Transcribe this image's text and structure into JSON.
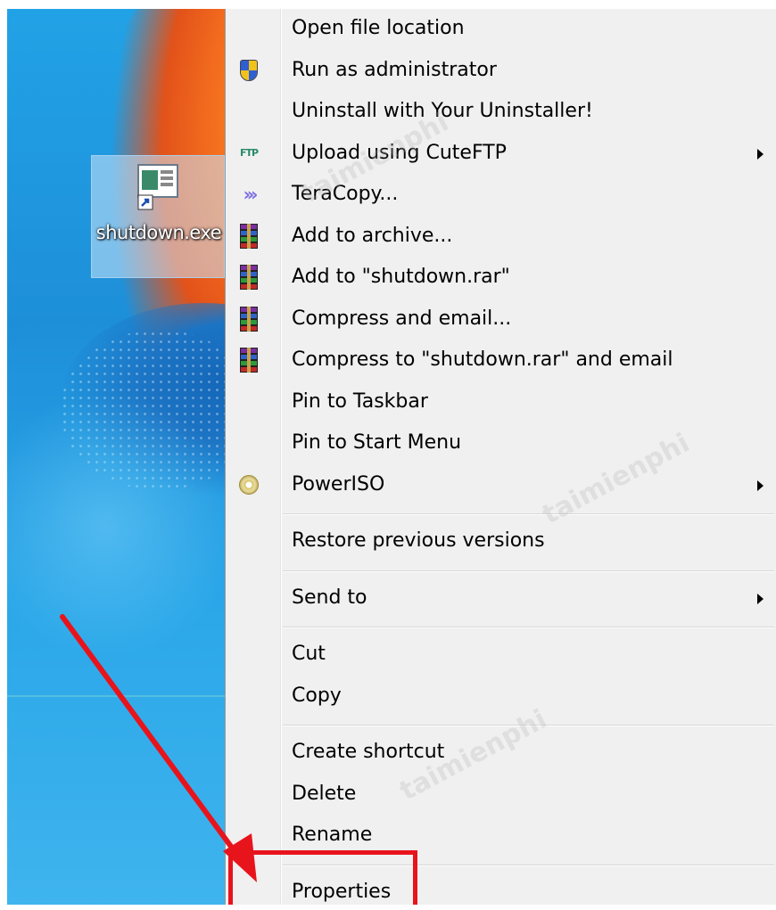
{
  "desktop": {
    "icon_label": "shutdown.exe"
  },
  "context_menu": {
    "groups": [
      [
        {
          "label": "Open file location",
          "icon": "none"
        },
        {
          "label": "Run as administrator",
          "icon": "uac-shield-icon"
        },
        {
          "label": "Uninstall with Your Uninstaller!",
          "icon": "none"
        },
        {
          "label": "Upload using CuteFTP",
          "icon": "cuteftp-icon",
          "submenu": true
        },
        {
          "label": "TeraCopy...",
          "icon": "teracopy-icon"
        },
        {
          "label": "Add to archive...",
          "icon": "winrar-icon"
        },
        {
          "label": "Add to \"shutdown.rar\"",
          "icon": "winrar-icon"
        },
        {
          "label": "Compress and email...",
          "icon": "winrar-icon"
        },
        {
          "label": "Compress to \"shutdown.rar\" and email",
          "icon": "winrar-icon"
        },
        {
          "label": "Pin to Taskbar",
          "icon": "none"
        },
        {
          "label": "Pin to Start Menu",
          "icon": "none"
        },
        {
          "label": "PowerISO",
          "icon": "poweriso-disc-icon",
          "submenu": true
        }
      ],
      [
        {
          "label": "Restore previous versions",
          "icon": "none"
        }
      ],
      [
        {
          "label": "Send to",
          "icon": "none",
          "submenu": true
        }
      ],
      [
        {
          "label": "Cut",
          "icon": "none"
        },
        {
          "label": "Copy",
          "icon": "none"
        }
      ],
      [
        {
          "label": "Create shortcut",
          "icon": "none"
        },
        {
          "label": "Delete",
          "icon": "none"
        },
        {
          "label": "Rename",
          "icon": "none"
        }
      ],
      [
        {
          "label": "Properties",
          "icon": "none"
        }
      ]
    ]
  },
  "colors": {
    "annotation_red": "#e8141c",
    "menu_background": "#f0f0f0",
    "desktop_blue": "#1d8fd9"
  }
}
